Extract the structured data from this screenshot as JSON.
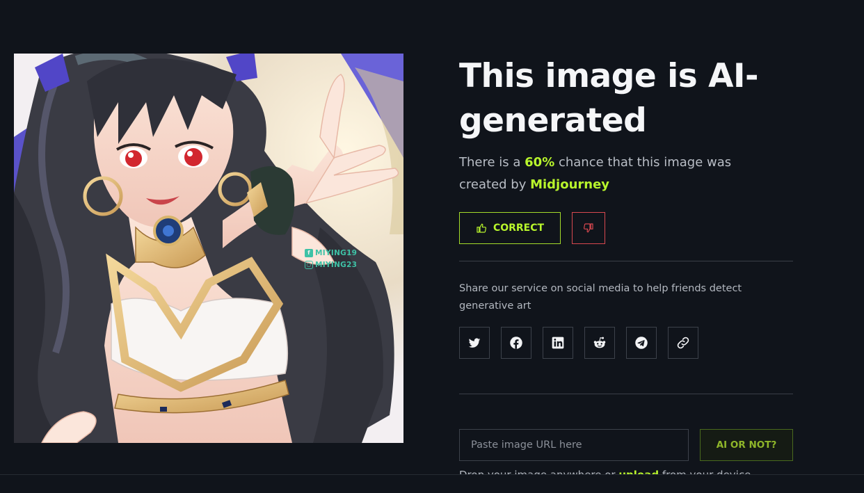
{
  "artwork": {
    "watermark_facebook": "MIYING19",
    "watermark_instagram": "MIYING23"
  },
  "result": {
    "title": "This image is AI-generated",
    "desc_prefix": "There is a ",
    "probability": "60%",
    "desc_middle": " chance that this image was created by ",
    "generator": "Midjourney"
  },
  "feedback": {
    "correct_label": "CORRECT"
  },
  "share": {
    "text": "Share our service on social media to help friends detect generative art",
    "buttons": [
      "twitter-icon",
      "facebook-icon",
      "linkedin-icon",
      "reddit-icon",
      "telegram-icon",
      "link-icon"
    ]
  },
  "check": {
    "url_placeholder": "Paste image URL here",
    "button_label": "AI OR NOT?",
    "drop_prefix": "Drop your image anywhere or ",
    "upload_link": "upload",
    "drop_suffix": " from your device"
  },
  "colors": {
    "background": "#10141b",
    "accent": "#b8f52c",
    "danger": "#d8484f"
  }
}
